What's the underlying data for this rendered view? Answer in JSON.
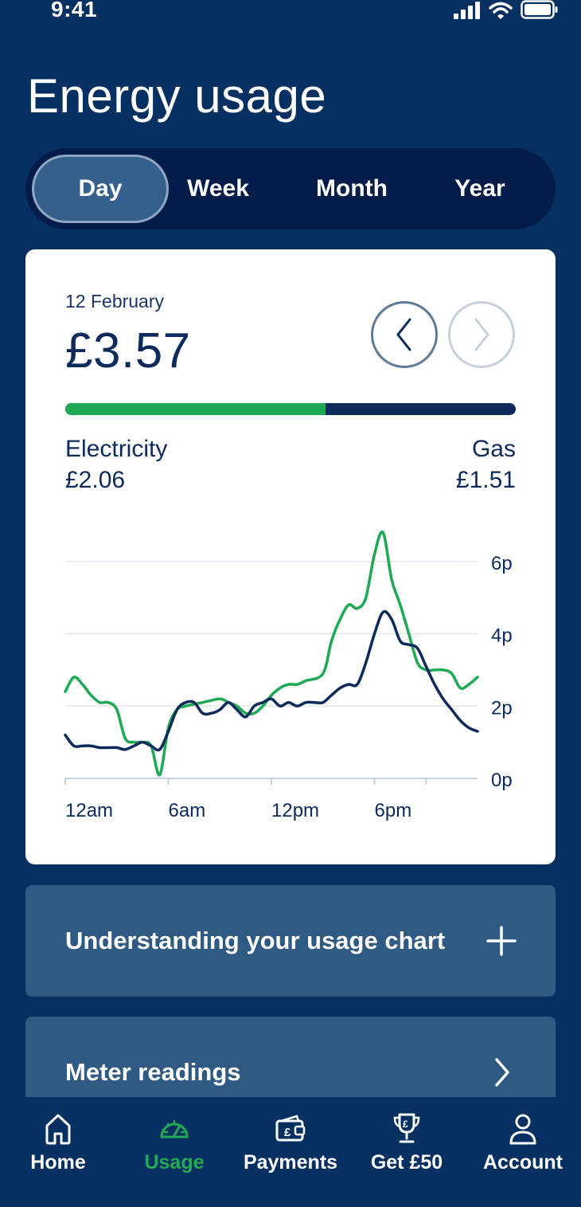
{
  "status": {
    "time": "9:41"
  },
  "title": "Energy usage",
  "periods": [
    {
      "label": "Day",
      "active": true
    },
    {
      "label": "Week",
      "active": false
    },
    {
      "label": "Month",
      "active": false
    },
    {
      "label": "Year",
      "active": false
    }
  ],
  "summary": {
    "date": "12 February",
    "total": "£3.57",
    "electricity_label": "Electricity",
    "electricity_value": "£2.06",
    "gas_label": "Gas",
    "gas_value": "£1.51",
    "electricity_share": 0.577
  },
  "colors": {
    "electricity": "#1ea954",
    "gas": "#0c2a5c",
    "background": "#063062",
    "accent": "#21a954"
  },
  "chart_data": {
    "type": "line",
    "x_ticks": [
      "12am",
      "6am",
      "12pm",
      "6pm"
    ],
    "y_ticks": [
      "0p",
      "2p",
      "4p",
      "6p"
    ],
    "ylim": [
      0,
      6.7
    ],
    "xlim": [
      0,
      24
    ],
    "grid": true,
    "series": [
      {
        "color": "#1ea954",
        "x": [
          0,
          0.5,
          1,
          1.5,
          2,
          2.5,
          3,
          3.5,
          4,
          4.5,
          5,
          5.5,
          6,
          6.5,
          7,
          8,
          9,
          9.5,
          10,
          10.5,
          11,
          11.5,
          12,
          12.5,
          13,
          13.5,
          14,
          15,
          15.5,
          16,
          16.5,
          17,
          17.5,
          18,
          18.5,
          19,
          19.5,
          20,
          20.5,
          21,
          21.5,
          22,
          22.5,
          23,
          23.5,
          24
        ],
        "y": [
          2.4,
          2.8,
          2.6,
          2.3,
          2.1,
          2.1,
          1.9,
          1.1,
          1.0,
          1.0,
          0.9,
          0.1,
          1.4,
          1.9,
          2.0,
          2.1,
          2.2,
          2.1,
          2.0,
          1.8,
          1.8,
          2.0,
          2.3,
          2.5,
          2.6,
          2.6,
          2.7,
          2.9,
          3.8,
          4.4,
          4.8,
          4.7,
          5.0,
          6.2,
          6.8,
          5.5,
          4.8,
          4.0,
          3.2,
          3.0,
          3.0,
          3.0,
          2.9,
          2.5,
          2.6,
          2.8
        ]
      },
      {
        "color": "#0c2a5c",
        "x": [
          0,
          0.5,
          1,
          1.5,
          2,
          2.5,
          3,
          3.5,
          4,
          4.5,
          5,
          5.5,
          6,
          6.5,
          7,
          7.5,
          8,
          8.5,
          9,
          9.5,
          10,
          10.5,
          11,
          11.5,
          12,
          12.5,
          13,
          13.5,
          14,
          14.5,
          15,
          15.5,
          16,
          16.5,
          17,
          17.5,
          18,
          18.5,
          19,
          19.5,
          20,
          20.5,
          21,
          21.5,
          22,
          22.5,
          23,
          23.5,
          24
        ],
        "y": [
          1.2,
          0.9,
          0.9,
          0.9,
          0.85,
          0.85,
          0.85,
          0.8,
          0.9,
          1.0,
          0.9,
          0.8,
          1.3,
          1.9,
          2.1,
          2.1,
          1.8,
          1.8,
          1.9,
          2.1,
          1.9,
          1.7,
          2.0,
          2.1,
          2.2,
          2.0,
          2.1,
          2.0,
          2.1,
          2.1,
          2.1,
          2.3,
          2.5,
          2.6,
          2.6,
          3.2,
          4.0,
          4.6,
          4.4,
          3.8,
          3.7,
          3.6,
          3.1,
          2.6,
          2.2,
          1.9,
          1.6,
          1.4,
          1.3
        ]
      }
    ]
  },
  "sections": [
    {
      "label": "Understanding your usage chart",
      "icon": "plus-icon"
    },
    {
      "label": "Meter readings",
      "icon": "chevron-right-icon"
    }
  ],
  "tabs": [
    {
      "label": "Home",
      "icon": "home-icon",
      "active": false
    },
    {
      "label": "Usage",
      "icon": "gauge-icon",
      "active": true
    },
    {
      "label": "Payments",
      "icon": "wallet-icon",
      "active": false
    },
    {
      "label": "Get £50",
      "icon": "trophy-icon",
      "active": false
    },
    {
      "label": "Account",
      "icon": "person-icon",
      "active": false
    }
  ]
}
